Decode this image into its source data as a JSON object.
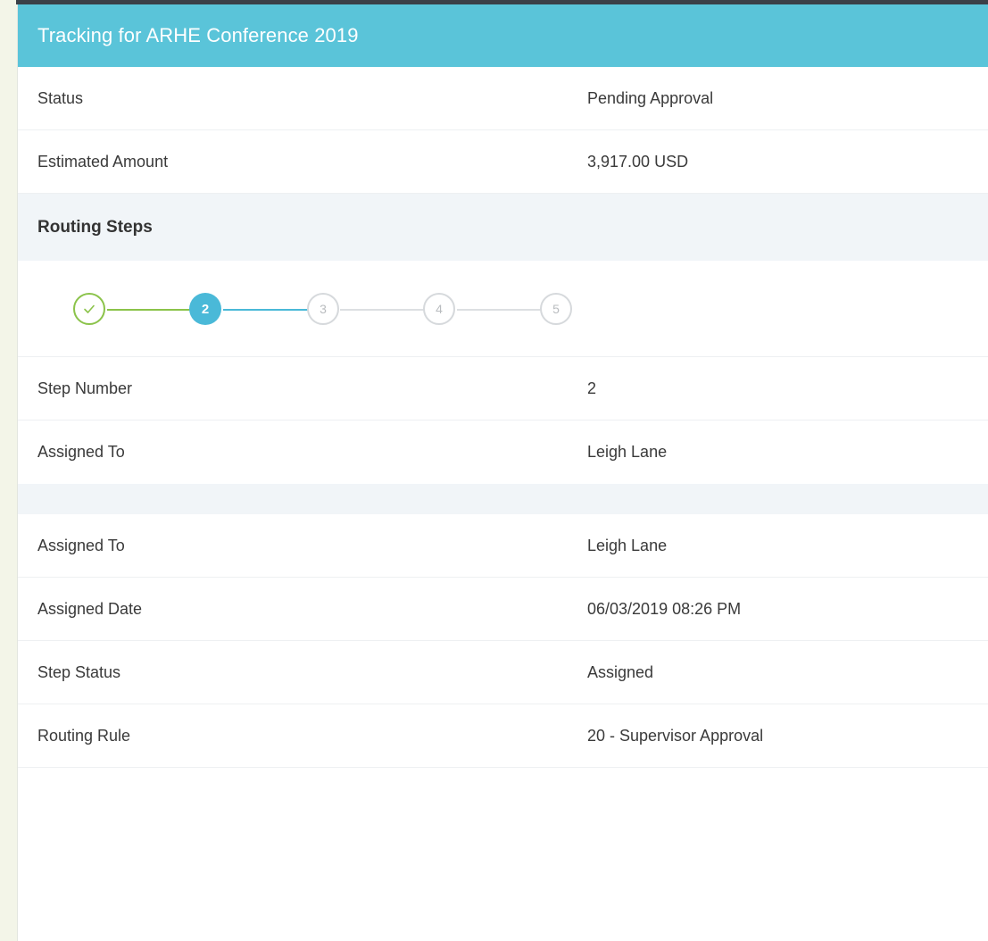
{
  "header": {
    "title": "Tracking for ARHE Conference 2019"
  },
  "summary": [
    {
      "label": "Status",
      "value": "Pending Approval"
    },
    {
      "label": "Estimated Amount",
      "value": "3,917.00 USD"
    }
  ],
  "routing": {
    "section_title": "Routing Steps",
    "steps": [
      {
        "label": "",
        "state": "complete",
        "icon": "check-icon"
      },
      {
        "label": "2",
        "state": "current"
      },
      {
        "label": "3",
        "state": "future"
      },
      {
        "label": "4",
        "state": "future"
      },
      {
        "label": "5",
        "state": "future"
      }
    ],
    "step_details": [
      {
        "label": "Step Number",
        "value": "2"
      },
      {
        "label": "Assigned To",
        "value": "Leigh Lane"
      }
    ],
    "assignment_details": [
      {
        "label": "Assigned To",
        "value": "Leigh Lane"
      },
      {
        "label": "Assigned Date",
        "value": "06/03/2019 08:26 PM"
      },
      {
        "label": "Step Status",
        "value": "Assigned"
      },
      {
        "label": "Routing Rule",
        "value": "20 - Supervisor Approval"
      }
    ]
  },
  "colors": {
    "header": "#5ac4d9",
    "complete": "#8bc34a",
    "current": "#4ab9d8",
    "future": "#d6d9dc"
  }
}
